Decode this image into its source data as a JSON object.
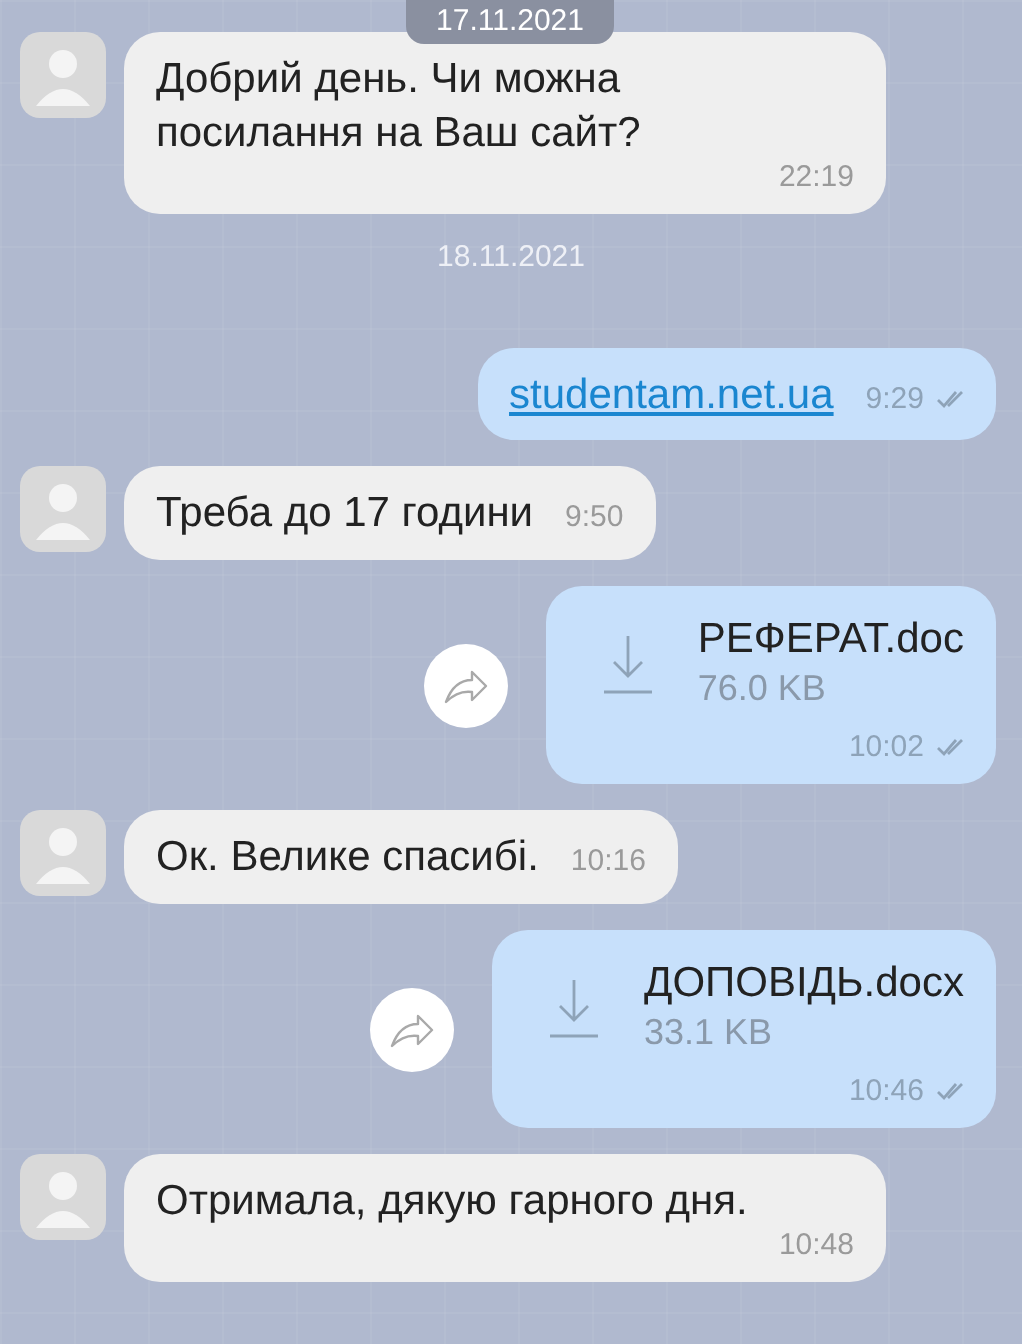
{
  "pinned_date": "17.11.2021",
  "messages": [
    {
      "kind": "incoming",
      "text": "Добрий день. Чи можна посилання на Ваш сайт?",
      "time": "22:19"
    },
    {
      "kind": "date",
      "text": "18.11.2021"
    },
    {
      "kind": "link",
      "text": "studentam.net.ua",
      "time": "9:29",
      "read": true
    },
    {
      "kind": "incoming",
      "text": "Треба до 17 години",
      "time": "9:50"
    },
    {
      "kind": "file",
      "name": "РЕФЕРАТ.doc",
      "size": "76.0 KB",
      "time": "10:02",
      "read": true
    },
    {
      "kind": "incoming",
      "text": "Ок. Велике спасибі.",
      "time": "10:16"
    },
    {
      "kind": "file",
      "name": "ДОПОВІДЬ.docx",
      "size": "33.1 KB",
      "time": "10:46",
      "read": true
    },
    {
      "kind": "incoming",
      "text": "Отримала, дякую гарного дня.",
      "time": "10:48"
    }
  ]
}
